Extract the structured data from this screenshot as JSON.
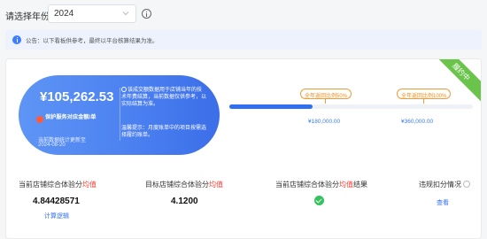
{
  "filter": {
    "year_label": "请选择年份:",
    "year_value": "2024"
  },
  "notice": {
    "text": "公告：以下看板供参考，最终以平台核算结果为准。"
  },
  "card": {
    "ribbon": "履约中",
    "bubble": {
      "amount": "¥105,262.53",
      "subtitle": "保护服务对应金额/单",
      "stat_time_label": "当前数据统计更新至",
      "stat_time_date": "2024-08-20",
      "info_text": "该成交额数据用于店铺当年的技术年费结算，当前数据仅供参考，以实际结算为准。",
      "tip_text": "温馨提示：月度账单中的项目按需选择履约账单。"
    },
    "progress": {
      "fraction": 0.34,
      "tiers": [
        {
          "tag": "全年返回比例50%",
          "value": "¥180,000.00"
        },
        {
          "tag": "全年返回比例100%",
          "value": "¥360,000.00"
        }
      ]
    },
    "metrics": {
      "m1_title_prefix": "当前店铺综合体验分",
      "m1_title_highlight": "均值",
      "m1_value": "4.84428571",
      "m1_link": "计算逻辑",
      "m2_title_prefix": "目标店铺综合体验分",
      "m2_title_highlight": "均值",
      "m2_value": "4.1200",
      "m3_title_prefix": "当前店铺综合体验分",
      "m3_title_highlight": "均值",
      "m3_title_suffix": "结果",
      "m4_title": "违规扣分情况",
      "m4_link": "查看"
    }
  },
  "colors": {
    "accent": "#2f6ff0",
    "ribbon": "#6ac44b",
    "highlight_red": "#ff3b30",
    "tier_orange": "#f39b35",
    "success": "#33c25e"
  }
}
